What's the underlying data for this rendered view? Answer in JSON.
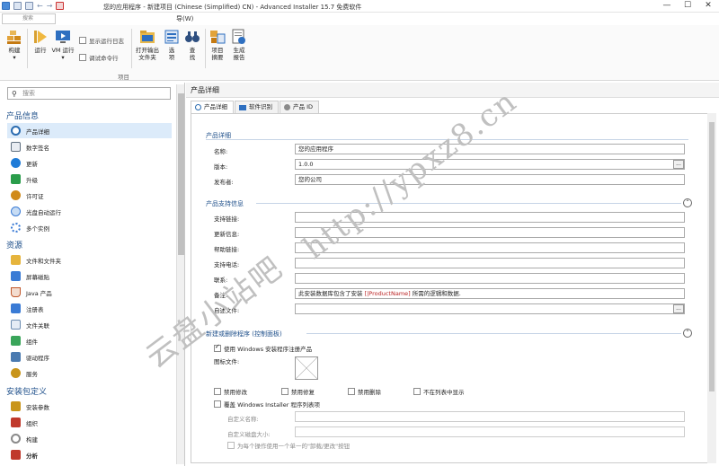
{
  "window": {
    "title": "您的应用程序 - 新建项目 (Chinese (Simplified) CN) - Advanced Installer 15.7 免费软件",
    "min": "—",
    "max": "☐",
    "close": "✕"
  },
  "menubar": {
    "search_placeholder": "搜索",
    "menu_item": "导(W)"
  },
  "ribbon": {
    "build": "构建",
    "run": "运行",
    "vm_run": "VM 运行",
    "show_log": "显示运行日志",
    "debug_cmd": "调试命令行",
    "open_output": "打开输出文件夹",
    "options": "选项",
    "find": "查找",
    "summary": "项目摘要",
    "report": "生成报告",
    "group_label": "项目"
  },
  "sidebar": {
    "search_placeholder": "搜索",
    "categories": [
      "产品信息",
      "资源",
      "安装包定义"
    ],
    "items": [
      {
        "label": "产品详细",
        "icon": "product-details-icon",
        "color": "#2b6cb0"
      },
      {
        "label": "数字签名",
        "icon": "digital-signature-icon",
        "color": "#607080"
      },
      {
        "label": "更新",
        "icon": "update-icon",
        "color": "#1e7bd8"
      },
      {
        "label": "升级",
        "icon": "upgrade-icon",
        "color": "#2a9d4b"
      },
      {
        "label": "许可证",
        "icon": "license-icon",
        "color": "#d08a1a"
      },
      {
        "label": "光盘自动运行",
        "icon": "autorun-icon",
        "color": "#3a7bd5"
      },
      {
        "label": "多个实例",
        "icon": "instances-icon",
        "color": "#3a7bd5"
      },
      {
        "label": "文件和文件夹",
        "icon": "folder-icon",
        "color": "#e6b43c"
      },
      {
        "label": "屏幕磁贴",
        "icon": "tiles-icon",
        "color": "#3a7bd5"
      },
      {
        "label": "Java 产品",
        "icon": "java-icon",
        "color": "#c0562a"
      },
      {
        "label": "注册表",
        "icon": "registry-icon",
        "color": "#3a7bd5"
      },
      {
        "label": "文件关联",
        "icon": "file-assoc-icon",
        "color": "#6a8bb0"
      },
      {
        "label": "组件",
        "icon": "components-icon",
        "color": "#3aa55a"
      },
      {
        "label": "驱动程序",
        "icon": "drivers-icon",
        "color": "#4a7ab0"
      },
      {
        "label": "服务",
        "icon": "services-icon",
        "color": "#c9951a"
      },
      {
        "label": "安装参数",
        "icon": "install-params-icon",
        "color": "#c9951a"
      },
      {
        "label": "组织",
        "icon": "organization-icon",
        "color": "#c0392b"
      },
      {
        "label": "构建",
        "icon": "build-icon",
        "color": "#8a8a8a"
      },
      {
        "label": "分析",
        "icon": "analytics-icon",
        "color": "#c0392b"
      }
    ]
  },
  "main": {
    "header": "产品详细",
    "tabs": [
      "产品详细",
      "软件识别",
      "产品 ID"
    ],
    "sections": {
      "details": "产品详细",
      "support": "产品支持信息",
      "addremove": "新建或删除程序 (控制面板)"
    },
    "fields": {
      "name_label": "名称:",
      "name_value": "您的应用程序",
      "version_label": "版本:",
      "version_value": "1.0.0",
      "publisher_label": "发布者:",
      "publisher_value": "您的公司",
      "support_link_label": "支持链接:",
      "update_info_label": "更新信息:",
      "help_link_label": "帮助链接:",
      "support_phone_label": "支持电话:",
      "contact_label": "联系:",
      "comment_label": "备注:",
      "comment_prefix": "此安装数据库包含了安装 ",
      "comment_token": "[|ProductName]",
      "comment_suffix": " 所需的逻辑和数据.",
      "readme_label": "自述文件:",
      "dots": "..."
    },
    "addremove": {
      "use_registry": "使用 Windows 安装程序注册产品",
      "icon_file": "图标文件:",
      "disable_modify": "禁用修改",
      "disable_repair": "禁用修复",
      "disable_remove": "禁用删除",
      "not_in_list": "不在列表中显示",
      "override_list": "覆盖 Windows Installer 程序列表项",
      "custom_name": "自定义名称:",
      "custom_size": "自定义磁盘大小:",
      "single_button": "为每个操作使用一个单一的\"卸载/更改\"按钮"
    }
  },
  "watermark": {
    "text1": "云盘小站吧",
    "text2": "http://ypxz8.cn"
  }
}
